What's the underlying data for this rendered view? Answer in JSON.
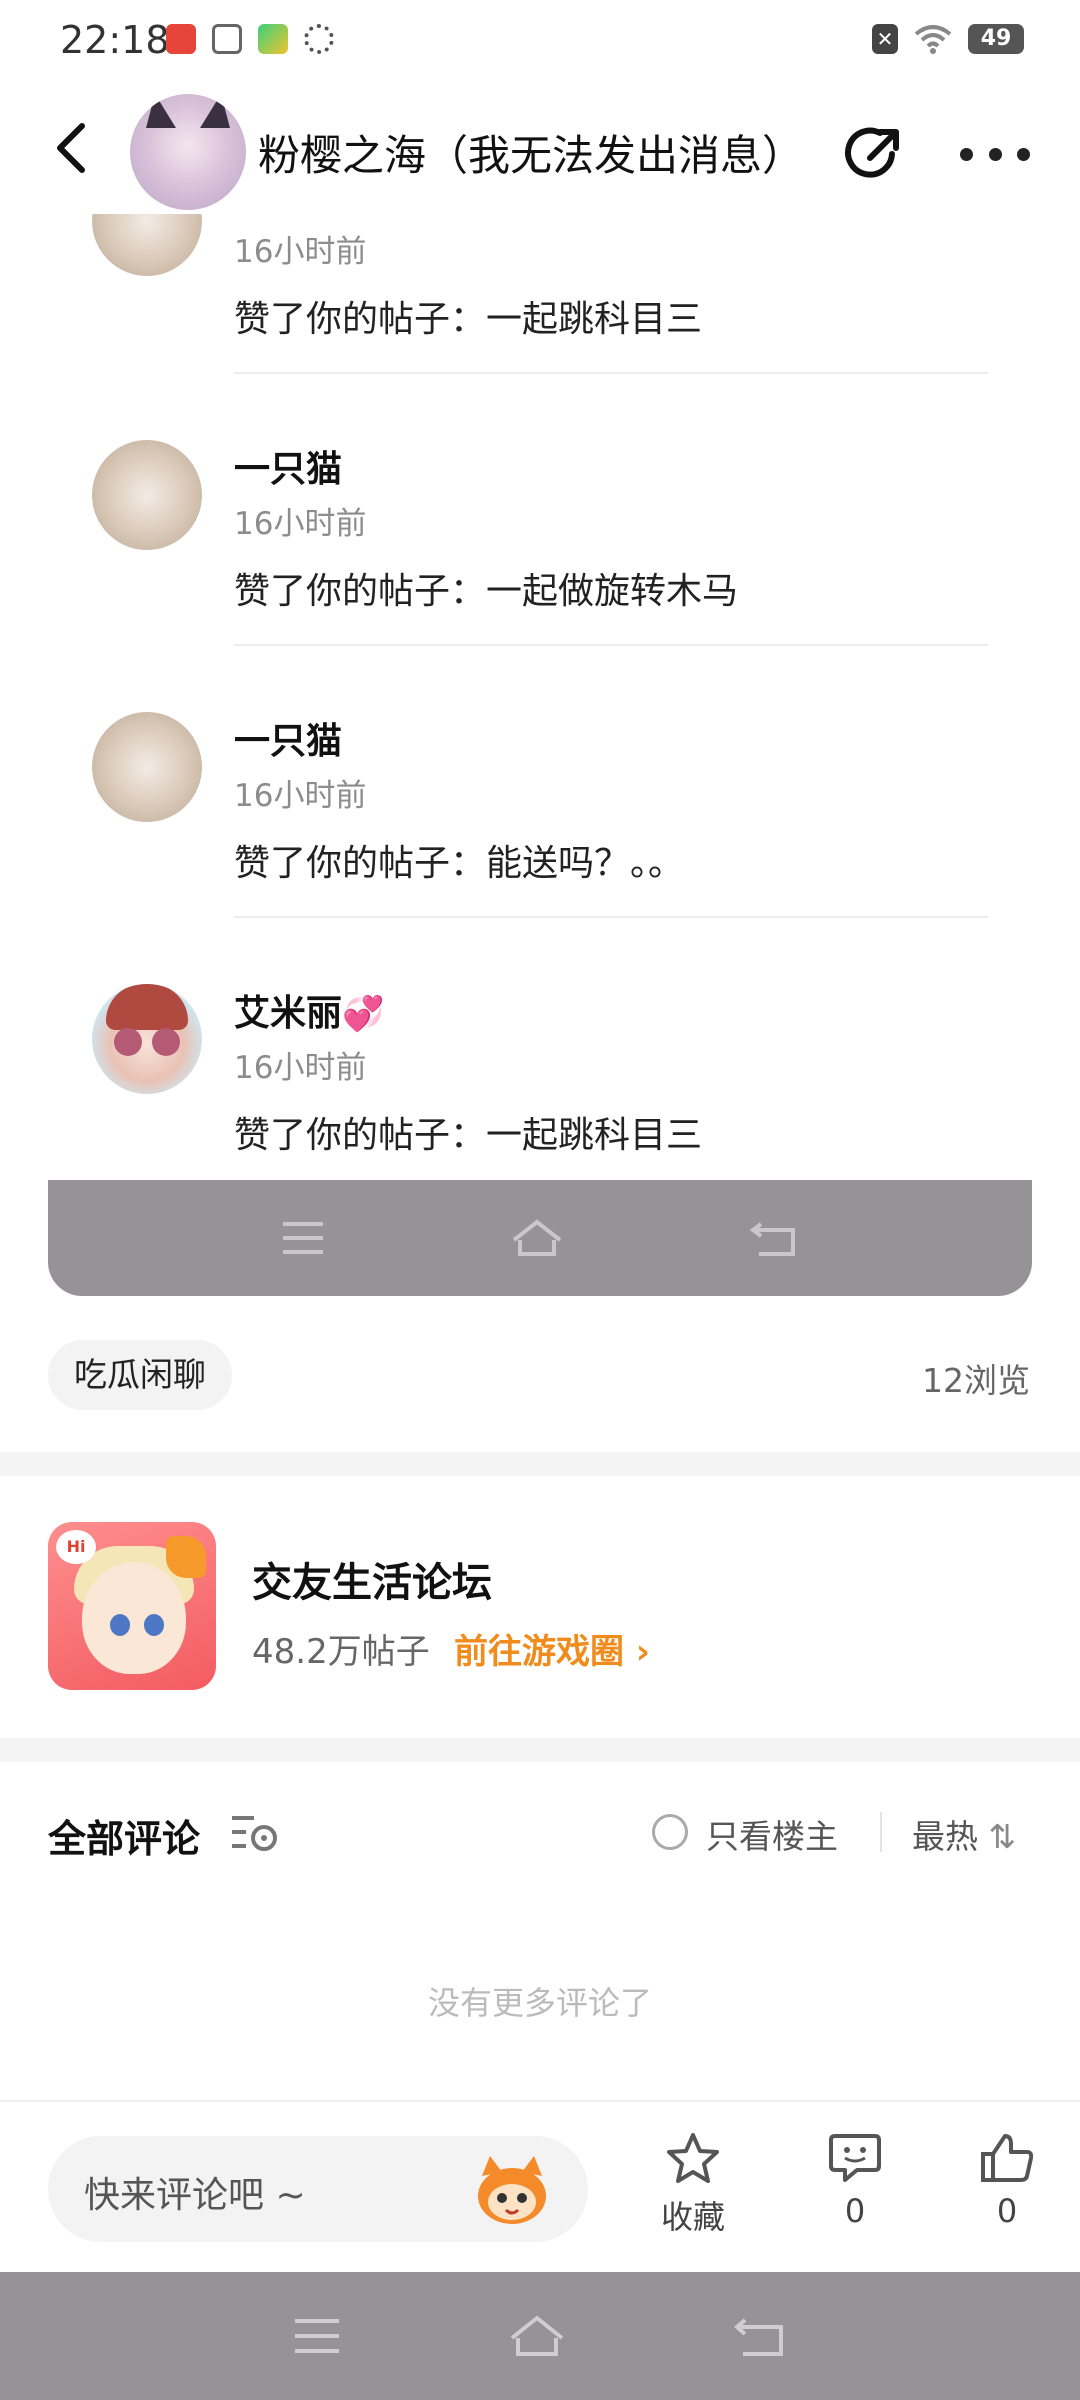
{
  "status_bar": {
    "time": "22:18",
    "battery": "49",
    "icons": [
      "app-icon-red",
      "document-icon",
      "video-icon",
      "paw-icon",
      "close-notification-icon",
      "wifi-icon",
      "battery-icon"
    ]
  },
  "header": {
    "title": "粉樱之海（我无法发出消息）",
    "icons": [
      "back-arrow-icon",
      "share-icon",
      "more-icon"
    ]
  },
  "notifications": [
    {
      "name": "",
      "time": "16小时前",
      "message": "赞了你的帖子：一起跳科目三"
    },
    {
      "name": "一只猫",
      "time": "16小时前",
      "message": "赞了你的帖子：一起做旋转木马"
    },
    {
      "name": "一只猫",
      "time": "16小时前",
      "message": "赞了你的帖子：能送吗？。。"
    },
    {
      "name": "艾米丽",
      "time": "16小时前",
      "message": "赞了你的帖子：一起跳科目三"
    }
  ],
  "tag": {
    "label": "吃瓜闲聊",
    "views": "12浏览"
  },
  "forum": {
    "name": "交友生活论坛",
    "posts": "48.2万帖子",
    "link": "前往游戏圈",
    "link_color": "#f08b1c",
    "icon_badge": "Hi"
  },
  "comments": {
    "title": "全部评论",
    "only_owner": "只看楼主",
    "sort": "最热",
    "empty_text": "没有更多评论了"
  },
  "bottom_bar": {
    "input_placeholder": "快来评论吧 ~",
    "favorite_label": "收藏",
    "comment_count": "0",
    "like_count": "0"
  },
  "colors": {
    "accent": "#f08b1c",
    "nav_bar": "#959396",
    "heart": "#ff5aa5"
  }
}
